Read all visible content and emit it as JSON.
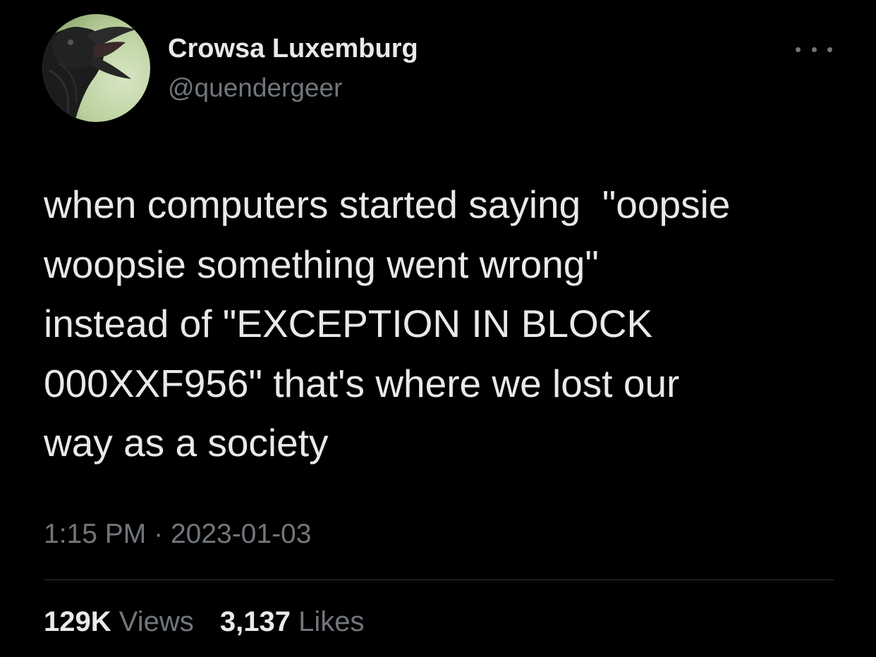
{
  "author": {
    "display_name": "Crowsa Luxemburg",
    "handle": "@quendergeer"
  },
  "more_icon": "more-horizontal-icon",
  "tweet": {
    "lines": [
      "when computers started saying  \"oopsie",
      "woopsie something went wrong\"",
      "instead of \"EXCEPTION IN BLOCK",
      "000XXF956\" that's where we lost our",
      "way as a society"
    ]
  },
  "meta": {
    "time": "1:15 PM",
    "separator": "·",
    "date": "2023-01-03"
  },
  "stats": {
    "views_count": "129K",
    "views_label": "Views",
    "likes_count": "3,137",
    "likes_label": "Likes"
  },
  "colors": {
    "background": "#000000",
    "primary_text": "#e7e9ea",
    "secondary_text": "#71767b",
    "divider": "#2f3336"
  }
}
